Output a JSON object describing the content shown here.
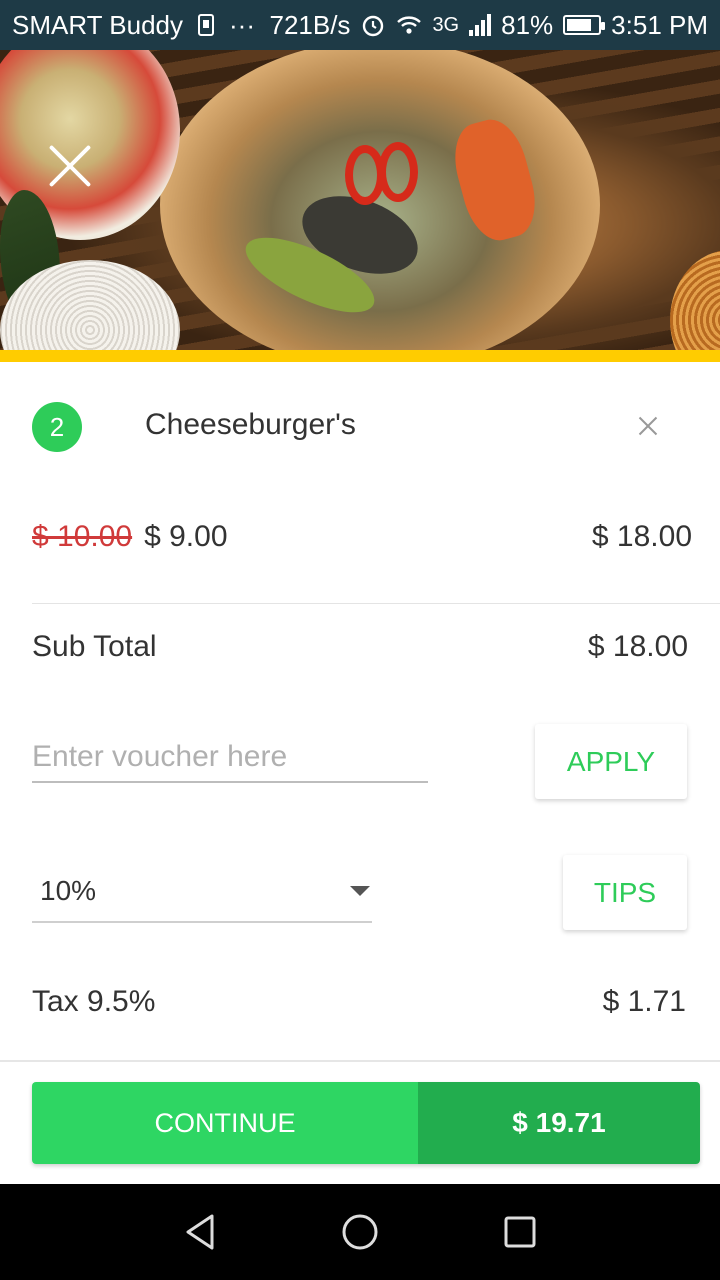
{
  "status_bar": {
    "carrier": "SMART Buddy",
    "dots": "···",
    "speed": "721B/s",
    "network": "3G",
    "battery": "81%",
    "battery_level": 0.81,
    "time": "3:51 PM"
  },
  "order": {
    "item": {
      "quantity": "2",
      "name": "Cheeseburger's",
      "original_price": "$ 10.00",
      "price": "$ 9.00",
      "line_total": "$ 18.00"
    },
    "subtotal": {
      "label": "Sub Total",
      "value": "$ 18.00"
    },
    "voucher": {
      "placeholder": "Enter voucher here",
      "value": "",
      "apply_label": "APPLY"
    },
    "tip": {
      "selected": "10%",
      "button_label": "TIPS"
    },
    "tax": {
      "label": "Tax 9.5%",
      "value": "$ 1.71"
    },
    "checkout": {
      "continue_label": "CONTINUE",
      "total": "$ 19.71"
    }
  },
  "colors": {
    "accent_green": "#2ecc59",
    "dark_green": "#22ad4e",
    "accent_yellow": "#ffcc00",
    "status_bar": "#1e3a46",
    "strikethrough": "#d03a3a"
  },
  "icons": {
    "hero_close": "close-icon",
    "item_remove": "close-icon",
    "nav_back": "triangle-back-icon",
    "nav_home": "circle-home-icon",
    "nav_recents": "square-recents-icon"
  }
}
